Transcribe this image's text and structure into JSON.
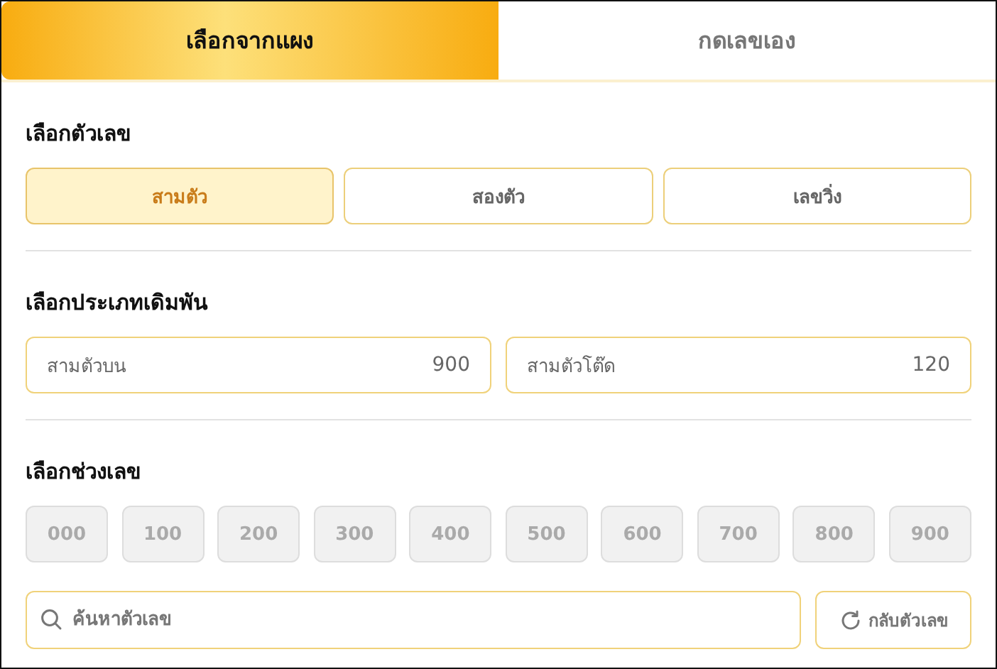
{
  "tabs": [
    {
      "label": "เลือกจากแผง",
      "selected": true
    },
    {
      "label": "กดเลขเอง",
      "selected": false
    }
  ],
  "digit_section": {
    "title": "เลือกตัวเลข",
    "options": [
      {
        "label": "สามตัว",
        "selected": true
      },
      {
        "label": "สองตัว",
        "selected": false
      },
      {
        "label": "เลขวิ่ง",
        "selected": false
      }
    ]
  },
  "bet_type_section": {
    "title": "เลือกประเภทเดิมพัน",
    "types": [
      {
        "label": "สามตัวบน",
        "value": "900"
      },
      {
        "label": "สามตัวโต๊ด",
        "value": "120"
      }
    ]
  },
  "range_section": {
    "title": "เลือกช่วงเลข",
    "ranges": [
      {
        "label": "000",
        "disabled": true
      },
      {
        "label": "100",
        "disabled": true
      },
      {
        "label": "200",
        "disabled": true
      },
      {
        "label": "300",
        "disabled": true
      },
      {
        "label": "400",
        "disabled": true
      },
      {
        "label": "500",
        "disabled": true
      },
      {
        "label": "600",
        "disabled": true
      },
      {
        "label": "700",
        "disabled": true
      },
      {
        "label": "800",
        "disabled": true
      },
      {
        "label": "900",
        "disabled": true
      }
    ]
  },
  "search": {
    "placeholder": "ค้นหาตัวเลข"
  },
  "reverse_button": {
    "label": "กลับตัวเลข"
  }
}
